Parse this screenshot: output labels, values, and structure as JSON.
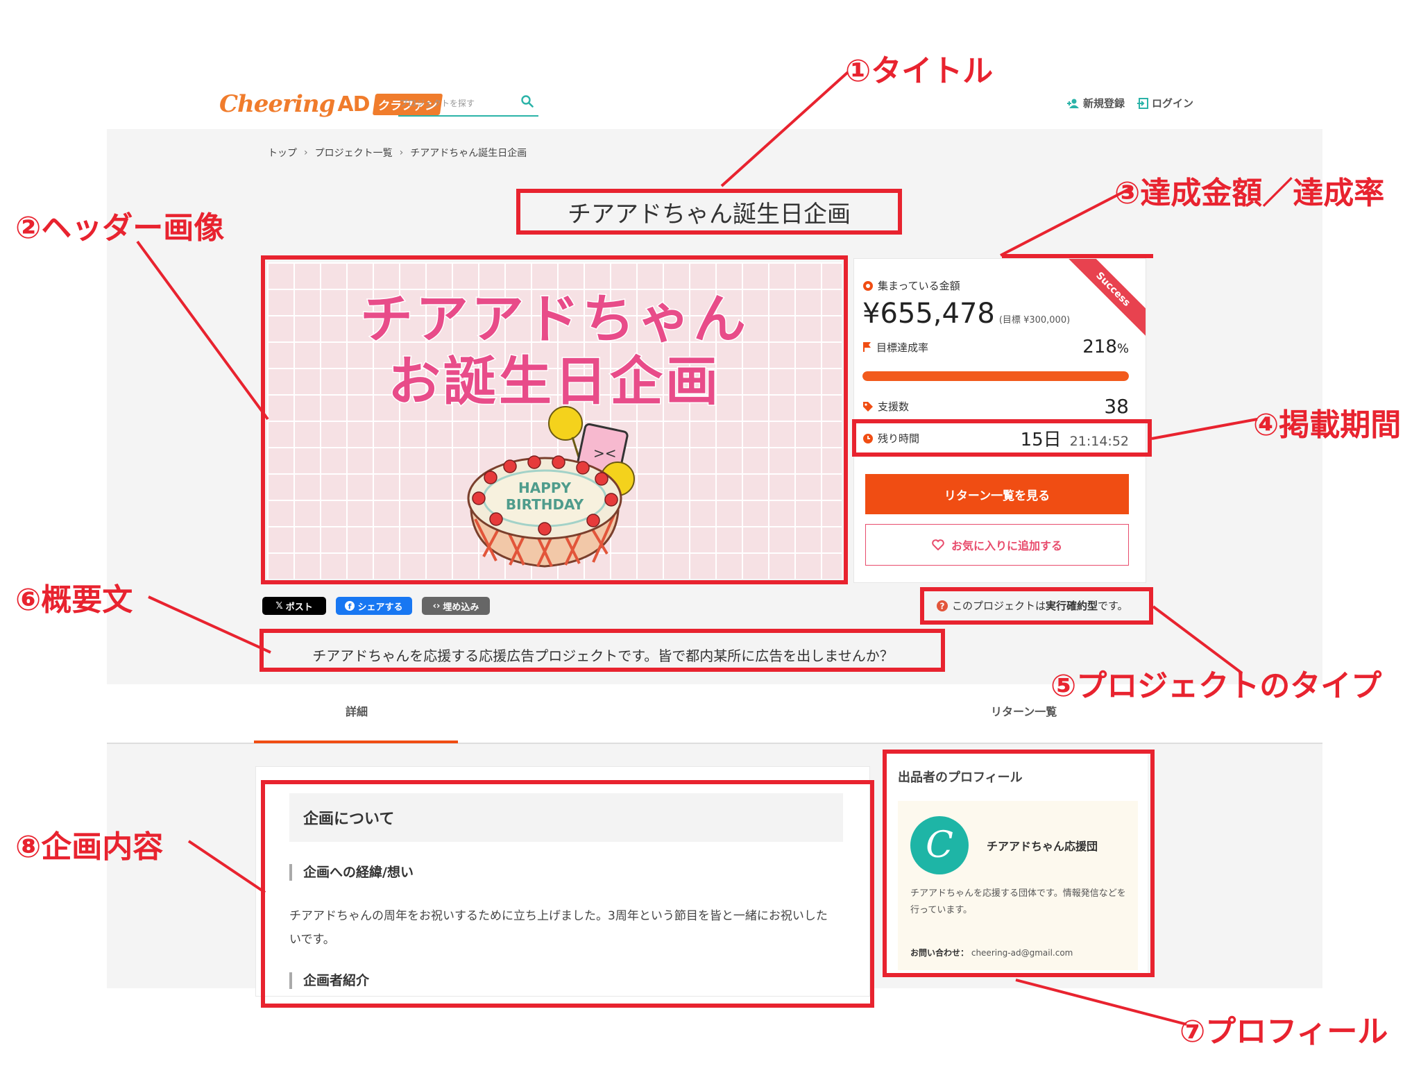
{
  "header": {
    "logo_text": "Cheering",
    "logo_ad": "AD",
    "logo_badge": "クラファン",
    "search_placeholder": "プロジェクトを探す",
    "signup_label": "新規登録",
    "login_label": "ログイン"
  },
  "breadcrumb": {
    "items": [
      "トップ",
      "プロジェクト一覧",
      "チアアドちゃん誕生日企画"
    ],
    "separator": "›"
  },
  "project": {
    "title": "チアアドちゃん誕生日企画",
    "hero_line1": "チアアドちゃん",
    "hero_line2": "お誕生日企画",
    "summary": "チアアドちゃんを応援する応援広告プロジェクトです。皆で都内某所に広告を出しませんか？",
    "type_note_prefix": "このプロジェクトは",
    "type_note_type": "実行確約型",
    "type_note_suffix": "です。"
  },
  "stats": {
    "ribbon": "Success",
    "collected_label": "集まっている金額",
    "amount": "¥655,478",
    "goal": "(目標 ¥300,000)",
    "rate_label": "目標達成率",
    "rate_value": "218",
    "rate_unit": "%",
    "progress_fraction": 1.0,
    "backers_label": "支援数",
    "backers_value": "38",
    "time_label": "残り時間",
    "time_days": "15日",
    "time_hms": "21:14:52",
    "returns_button": "リターン一覧を見る",
    "favorite_button": "お気に入りに追加する"
  },
  "share": {
    "x_label": "ポスト",
    "fb_label": "シェアする",
    "embed_label": "埋め込み"
  },
  "tabs": {
    "details": "詳細",
    "returns": "リターン一覧"
  },
  "content": {
    "about_heading": "企画について",
    "motive_heading": "企画への経緯/想い",
    "motive_body": "チアアドちゃんの周年をお祝いするために立ち上げました。3周年という節目を皆と一緒にお祝いしたいです。",
    "planner_heading": "企画者紹介"
  },
  "profile": {
    "title": "出品者のプロフィール",
    "avatar_letter": "C",
    "name": "チアアドちゃん応援団",
    "description": "チアアドちゃんを応援する団体です。情報発信などを行っています。",
    "contact_label": "お問い合わせ：",
    "contact_email": "cheering-ad@gmail.com"
  },
  "cake": {
    "happy": "HAPPY",
    "birthday": "BIRTHDAY"
  },
  "annotations": {
    "a1": "①タイトル",
    "a2": "②ヘッダー画像",
    "a3": "③達成金額／達成率",
    "a4": "④掲載期間",
    "a5": "⑤プロジェクトのタイプ",
    "a6": "⑥概要文",
    "a7": "⑦プロフィール",
    "a8": "⑧企画内容"
  },
  "colors": {
    "accent_orange": "#f04d13",
    "annotation_red": "#e8232f",
    "teal": "#1eb5a6",
    "hero_pink": "#e84c89"
  }
}
